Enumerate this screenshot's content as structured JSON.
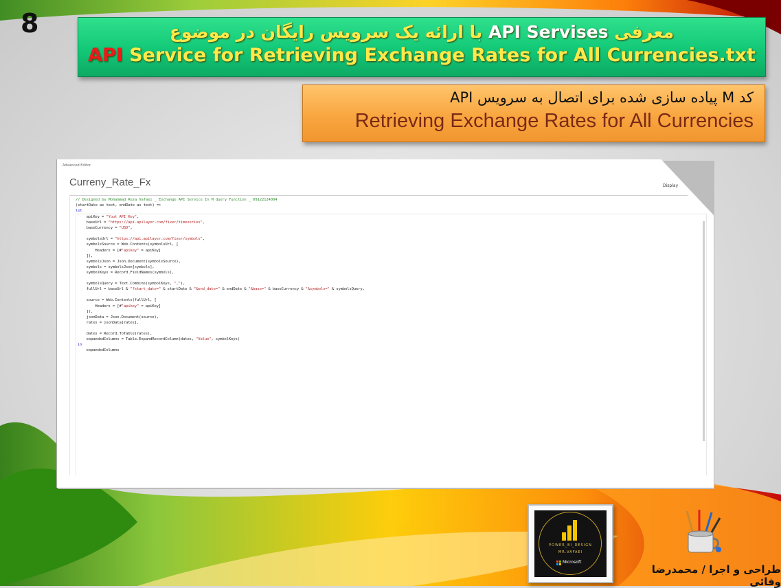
{
  "slide": {
    "number": "8"
  },
  "title": {
    "line1_prefix": "معرفی",
    "line1_highlight": "API Servises",
    "line1_suffix": "با ارائه یک سرویس رایگان در موضوع",
    "line2_red": "API",
    "line2_rest": "Service for Retrieving Exchange Rates for All Currencies.txt"
  },
  "subtitle": {
    "line1": "کد M پیاده سازی شده برای اتصال به سرویس API",
    "line2": "Retrieving Exchange Rates for All Currencies"
  },
  "editor": {
    "top_label": "Advanced Editor",
    "query_name": "Curreny_Rate_Fx",
    "display_button": "Display",
    "code_header": [
      {
        "cls": "cmt",
        "text": "// Designed by Mohammad Reza Vafaei _ Exchange API Service In M Query Function _ 09122124004"
      },
      {
        "cls": "",
        "text": "(startDate as text, endDate as text) =>"
      },
      {
        "cls": "kw",
        "text": "let"
      }
    ],
    "code_lines": [
      "    apiKey = \"Yout API Key\",",
      "    baseUrl = \"https://api.apilayer.com/fixer/timeseries\",",
      "    baseCurrency = \"USD\",",
      "",
      "    symbolsUrl = \"https://api.apilayer.com/fixer/symbols\",",
      "    symbolsSource = Web.Contents(symbolsUrl, [",
      "        Headers = [#\"apikey\" = apiKey]",
      "    ]),",
      "    symbolsJson = Json.Document(symbolsSource),",
      "    symbols = symbolsJson[symbols],",
      "    symbolKeys = Record.FieldNames(symbols),",
      "",
      "    symbolsQuery = Text.Combine(symbolKeys, \",\"),",
      "    fullUrl = baseUrl & \"?start_date=\" & startDate & \"&end_date=\" & endDate & \"&base=\" & baseCurrency & \"&symbols=\" & symbolsQuery,",
      "",
      "    source = Web.Contents(fullUrl, [",
      "        Headers = [#\"apikey\" = apiKey]",
      "    ]),",
      "    jsonData = Json.Document(source),",
      "    rates = jsonData[rates],",
      "",
      "    dates = Record.ToTable(rates),",
      "    expandedColumns = Table.ExpandRecordColumn(dates, \"Value\", symbolKeys)",
      "in",
      "    expandedColumns"
    ]
  },
  "logo": {
    "line1": "POWER_BI_DESIGN",
    "line2": "MR.VAFAEI",
    "ms_text": "Microsoft",
    "icon": "power-bi-logo"
  },
  "credit": {
    "text": "طراحی و اجرا / محمدرضا وفائی"
  },
  "colors": {
    "title_green": "#12c877",
    "title_yellow": "#ffe94a",
    "title_red": "#e81c1c",
    "subtitle_orange": "#f9a640",
    "subtitle_text": "#7a2a16"
  }
}
